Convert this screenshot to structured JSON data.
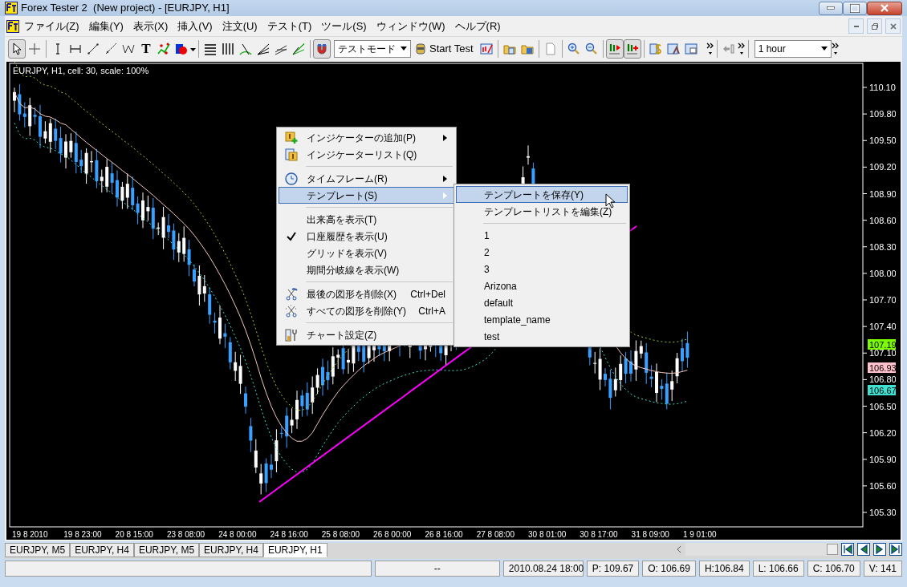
{
  "window": {
    "title": "Forex Tester 2  (New project) - [EURJPY, H1]"
  },
  "menu": [
    "ファイル(Z)",
    "編集(Y)",
    "表示(X)",
    "挿入(V)",
    "注文(U)",
    "テスト(T)",
    "ツール(S)",
    "ウィンドウ(W)",
    "ヘルプ(R)"
  ],
  "toolbar": {
    "text_tool": "T",
    "mode_select": "テストモード",
    "start_test": "Start Test",
    "timeframe_select": "1 hour"
  },
  "chart": {
    "info": "EURJPY, H1, cell: 30, scale: 100%",
    "price_labels": [
      "110.10",
      "109.80",
      "109.50",
      "109.20",
      "108.90",
      "108.60",
      "108.30",
      "108.00",
      "107.70",
      "107.40",
      "107.10",
      "106.80",
      "106.50",
      "106.20",
      "105.90",
      "105.60",
      "105.30"
    ],
    "time_labels": [
      "19 8 2010",
      "19 8 23:00",
      "20 8 15:00",
      "23 8 08:00",
      "24 8 00:00",
      "24 8 16:00",
      "25 8 08:00",
      "26 8 00:00",
      "26 8 16:00",
      "27 8 08:00",
      "30 8 01:00",
      "30 8 17:00",
      "31 8 09:00",
      "1 9 01:00"
    ],
    "price_tags": [
      {
        "text": "107.19",
        "color": "#7cfc00"
      },
      {
        "text": "106.93",
        "color": "#ffc0cb"
      },
      {
        "text": "106.67",
        "color": "#40e0d0"
      }
    ]
  },
  "context_menu": [
    {
      "kind": "item",
      "label": "インジケーターの追加(P)",
      "submenu": true,
      "checked": false,
      "selected": false
    },
    {
      "kind": "item",
      "label": "インジケーターリスト(Q)",
      "submenu": false,
      "checked": false,
      "selected": false
    },
    {
      "kind": "separator"
    },
    {
      "kind": "item",
      "label": "タイムフレーム(R)",
      "submenu": true,
      "checked": false,
      "selected": false
    },
    {
      "kind": "item",
      "label": "テンプレート(S)",
      "submenu": true,
      "checked": false,
      "selected": true
    },
    {
      "kind": "separator"
    },
    {
      "kind": "item",
      "label": "出来高を表示(T)",
      "submenu": false,
      "checked": false,
      "selected": false
    },
    {
      "kind": "item",
      "label": "口座履歴を表示(U)",
      "submenu": false,
      "checked": true,
      "selected": false
    },
    {
      "kind": "item",
      "label": "グリッドを表示(V)",
      "submenu": false,
      "checked": false,
      "selected": false
    },
    {
      "kind": "item",
      "label": "期間分岐線を表示(W)",
      "submenu": false,
      "checked": false,
      "selected": false
    },
    {
      "kind": "separator"
    },
    {
      "kind": "item",
      "label": "最後の図形を削除(X)",
      "shortcut": "Ctrl+Del",
      "submenu": false,
      "checked": false,
      "selected": false
    },
    {
      "kind": "item",
      "label": "すべての図形を削除(Y)",
      "shortcut": "Ctrl+A",
      "submenu": false,
      "checked": false,
      "selected": false
    },
    {
      "kind": "separator"
    },
    {
      "kind": "item",
      "label": "チャート設定(Z)",
      "submenu": false,
      "checked": false,
      "selected": false
    }
  ],
  "template_submenu": [
    {
      "kind": "item",
      "label": "テンプレートを保存(Y)",
      "selected": true
    },
    {
      "kind": "item",
      "label": "テンプレートリストを編集(Z)",
      "selected": false
    },
    {
      "kind": "separator"
    },
    {
      "kind": "item",
      "label": "1",
      "selected": false
    },
    {
      "kind": "item",
      "label": "2",
      "selected": false
    },
    {
      "kind": "item",
      "label": "3",
      "selected": false
    },
    {
      "kind": "item",
      "label": "Arizona",
      "selected": false
    },
    {
      "kind": "item",
      "label": "default",
      "selected": false
    },
    {
      "kind": "item",
      "label": "template_name",
      "selected": false
    },
    {
      "kind": "item",
      "label": "test",
      "selected": false
    }
  ],
  "chart_tabs": [
    {
      "label": "EURJPY, M5",
      "selected": false
    },
    {
      "label": "EURJPY, H4",
      "selected": false
    },
    {
      "label": "EURJPY, M5",
      "selected": false
    },
    {
      "label": "EURJPY, H4",
      "selected": false
    },
    {
      "label": "EURJPY, H1",
      "selected": true
    }
  ],
  "status_bar": [
    "--",
    "2010.08.24 18:00",
    "P: 109.67",
    "O: 106.69",
    "H:106.84",
    "L: 106.66",
    "C: 106.70",
    "V: 141"
  ]
}
